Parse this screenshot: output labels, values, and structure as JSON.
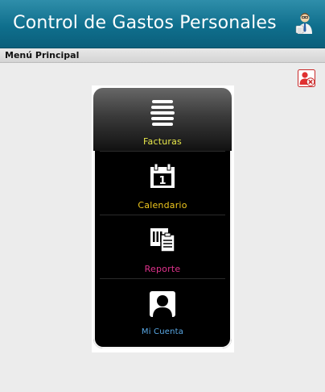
{
  "header": {
    "title": "Control de Gastos Personales",
    "app_icon": "accountant-person-icon"
  },
  "subheader": {
    "section": "Menú Principal"
  },
  "toolbar": {
    "logout_icon": "user-remove-icon"
  },
  "menu": {
    "items": [
      {
        "label": "Facturas",
        "icon": "list-lines-icon",
        "color": "#e8e84a"
      },
      {
        "label": "Calendario",
        "icon": "calendar-icon",
        "color": "#f0c81e"
      },
      {
        "label": "Reporte",
        "icon": "report-icon",
        "color": "#e0328c"
      },
      {
        "label": "Mi Cuenta",
        "icon": "account-avatar-icon",
        "color": "#5aa9e6"
      }
    ]
  },
  "calendar_icon_day": "1"
}
